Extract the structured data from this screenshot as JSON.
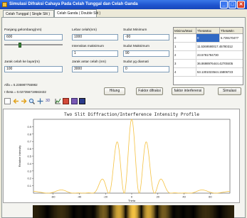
{
  "window": {
    "title": "Simulasi Difraksi Cahaya Pada Celah Tunggal dan Celah Ganda",
    "min_label": "_",
    "max_label": "□",
    "close_label": "✕"
  },
  "tabs": [
    {
      "label": "Celah Tunggal ( Single Slit )"
    },
    {
      "label": "Celah Ganda ( Double Slit )"
    }
  ],
  "form": {
    "wavelength_label": "Panjang gelombang(nm)",
    "wavelength_value": "600",
    "wavelength_slider_fraction": 0.25,
    "slit_width_label": "Lebar celah(nm)",
    "slit_width_value": "1000",
    "min_angle_label": "Sudut Minimum",
    "min_angle_value": "-90",
    "max_intensity_label": "Intensitas maksimum",
    "max_intensity_value": "1",
    "max_angle_label": "Sudut Maksimum",
    "max_angle_value": "90",
    "screen_distance_label": "Jarak celah ke layar(m)",
    "screen_distance_value": "100",
    "slit_distance_label": "Jarak antar celah (nm)",
    "slit_distance_value": "3000",
    "angle_step_label": "Sudut yg diamati",
    "angle_step_value": "0"
  },
  "results": {
    "alfa": "Alfa = 5.235987755982",
    "theta": "I theta = 0.027356719563432"
  },
  "buttons": {
    "compute": "Hitung",
    "diffraction_factor": "Faktor difraksi",
    "interference_factor": "faktor interferensi",
    "simulate": "Simulasi"
  },
  "table": {
    "headers": [
      "Minima/Maxi",
      "ThetaMax",
      "ThetaMin"
    ],
    "rows": [
      [
        "0",
        "0",
        "5.739170477"
      ],
      [
        "1",
        "11.5369590017.45780312",
        ""
      ],
      [
        "2",
        "23.5781784730",
        ""
      ],
      [
        "3",
        "36.8698976444.42700405",
        ""
      ],
      [
        "4",
        "53.1301023544.15806723",
        ""
      ]
    ]
  },
  "toolbar_icons": [
    "home-icon",
    "back-icon",
    "forward-icon",
    "zoom-icon",
    "pan-icon",
    "3d-icon",
    "chart-edit-icon",
    "export-icon",
    "image-icon",
    "save-icon"
  ],
  "chart_data": {
    "type": "line",
    "title": "Two Slit Diffraction/Interference Intensity Profile",
    "xlabel": "Theta",
    "ylabel": "Relative Intensity",
    "xlim": [
      -75,
      75
    ],
    "ylim": [
      0,
      1.0
    ],
    "xticks": [
      "-60",
      "-40",
      "-20",
      "0",
      "20",
      "40",
      "60"
    ],
    "yticks": [
      "0.1",
      "0.2",
      "0.3",
      "0.4",
      "0.5",
      "0.6",
      "0.7",
      "0.8",
      "0.9"
    ],
    "series_color": "#f5c242",
    "slit_width_nm": 1000,
    "slit_distance_nm": 3000,
    "wavelength_nm": 600
  }
}
